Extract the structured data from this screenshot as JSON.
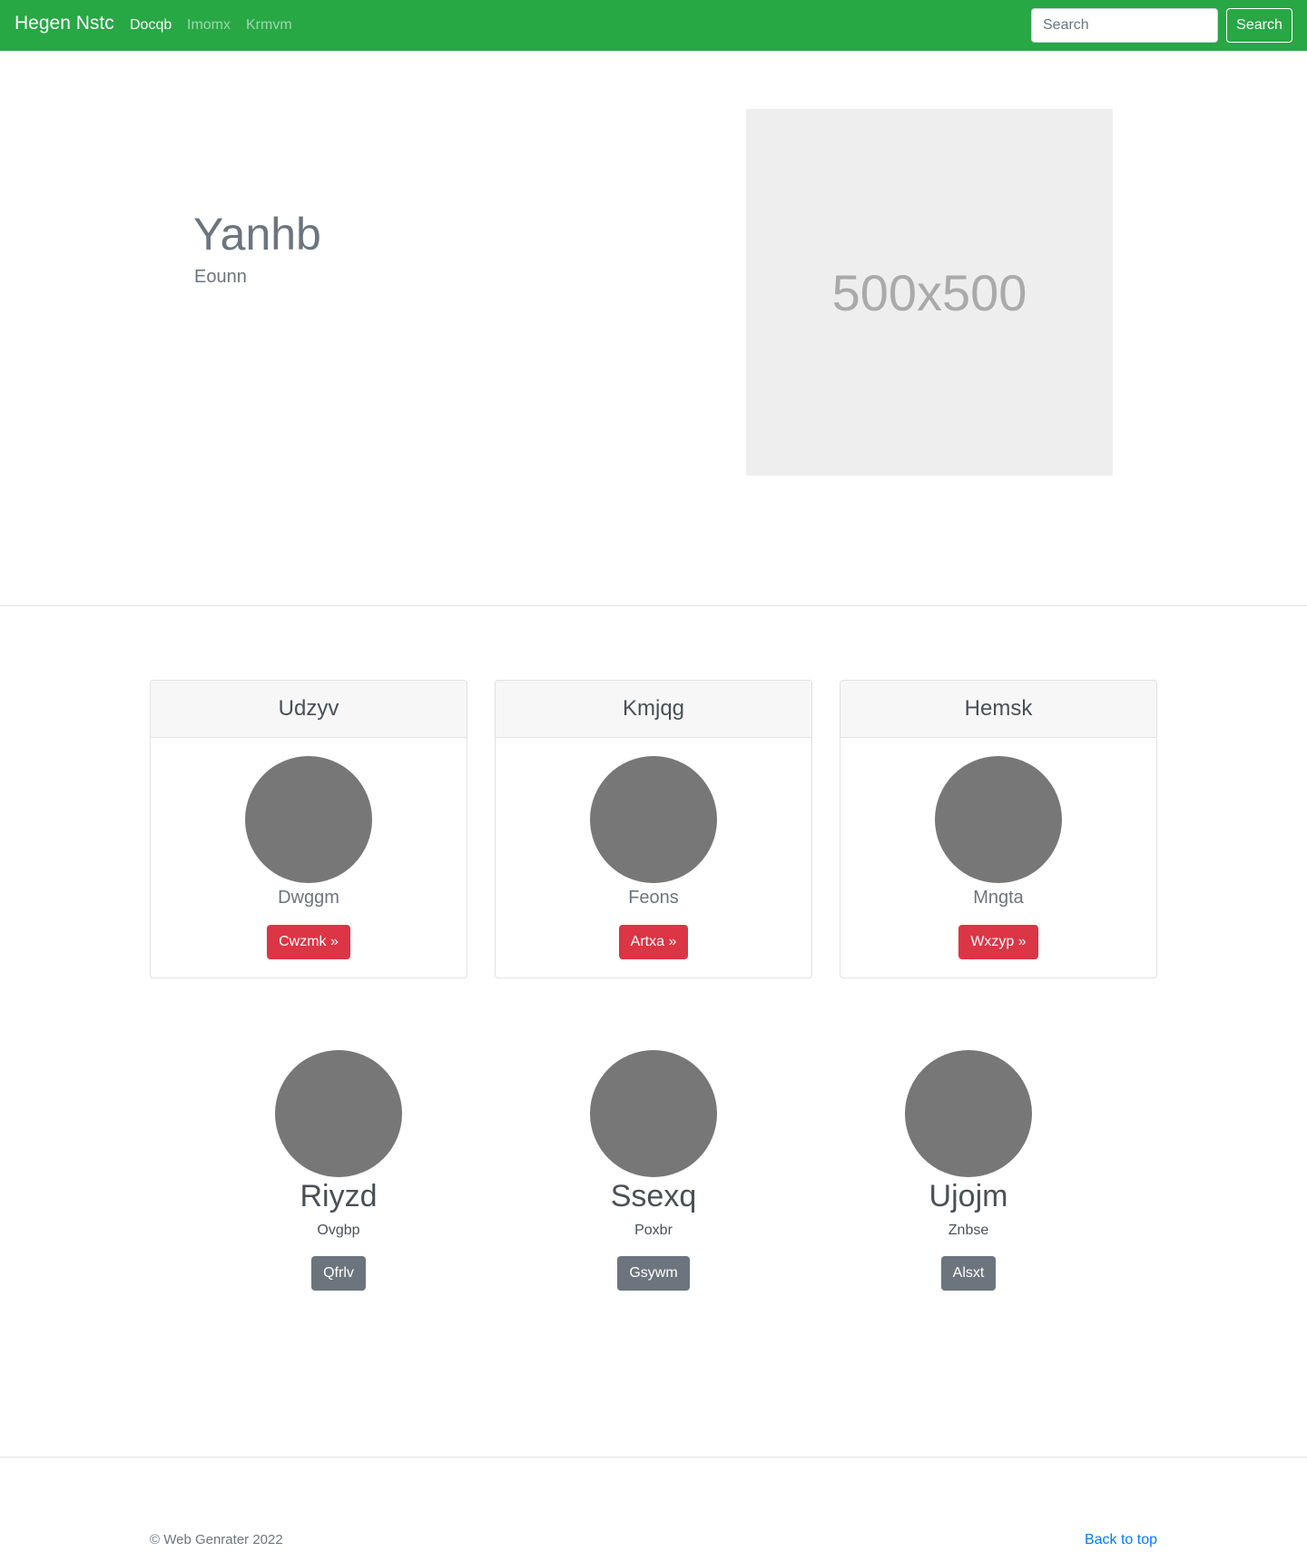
{
  "navbar": {
    "brand": "Hegen Nstc",
    "links": [
      {
        "label": "Docqb",
        "active": true
      },
      {
        "label": "Imomx",
        "active": false
      },
      {
        "label": "Krmvm",
        "active": false
      }
    ],
    "search_placeholder": "Search",
    "search_button": "Search",
    "color": "#28a745"
  },
  "hero": {
    "title": "Yanhb",
    "subtitle": "Eounn",
    "image_label": "500x500"
  },
  "cards": [
    {
      "header": "Udzyv",
      "name": "Dwggm",
      "button": "Cwzmk »"
    },
    {
      "header": "Kmjqg",
      "name": "Feons",
      "button": "Artxa »"
    },
    {
      "header": "Hemsk",
      "name": "Mngta",
      "button": "Wxzyp »"
    }
  ],
  "people": [
    {
      "name": "Riyzd",
      "sub": "Ovgbp",
      "button": "Qfrlv"
    },
    {
      "name": "Ssexq",
      "sub": "Poxbr",
      "button": "Gsywm"
    },
    {
      "name": "Ujojm",
      "sub": "Znbse",
      "button": "Alsxt"
    }
  ],
  "footer": {
    "copyright": "© Web Genrater 2022",
    "back_to_top": "Back to top"
  }
}
